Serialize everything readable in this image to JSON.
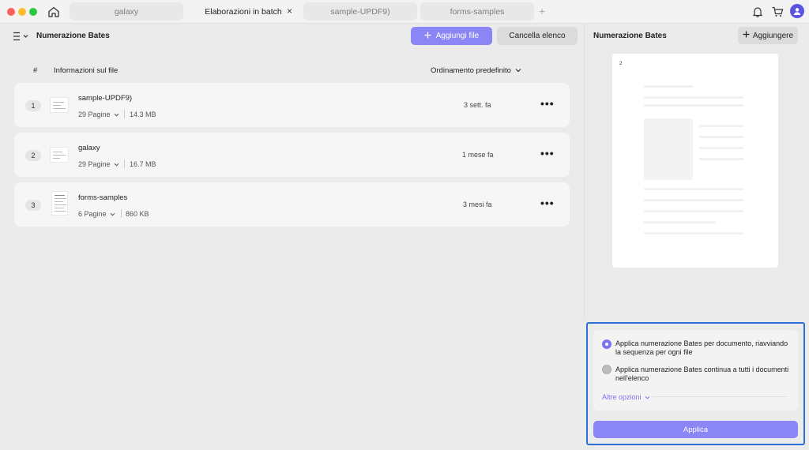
{
  "tabs": [
    {
      "label": "galaxy"
    },
    {
      "label": "Elaborazioni in batch"
    },
    {
      "label": "sample-UPDF9)"
    },
    {
      "label": "forms-samples"
    }
  ],
  "tab_close": "×",
  "tab_add": "+",
  "toolbar": {
    "title": "Numerazione Bates",
    "add_files_label": "Aggiungi file",
    "clear_list_label": "Cancella elenco"
  },
  "list": {
    "col_number": "#",
    "col_info": "Informazioni sul file",
    "sort_label": "Ordinamento predefinito",
    "rows": [
      {
        "index": "1",
        "name": "sample-UPDF9)",
        "pages": "29 Pagine",
        "size": "14.3 MB",
        "time": "3 sett. fa"
      },
      {
        "index": "2",
        "name": "galaxy",
        "pages": "29 Pagine",
        "size": "16.7 MB",
        "time": "1 mese fa"
      },
      {
        "index": "3",
        "name": "forms-samples",
        "pages": "6 Pagine",
        "size": "860 KB",
        "time": "3 mesi fa"
      }
    ],
    "more_glyph": "•••"
  },
  "right_panel": {
    "title": "Numerazione Bates",
    "add_label": "Aggiungere",
    "preview_stamp": "2",
    "option_per_document": "Applica numerazione Bates per documento, riavviando la sequenza per ogni file",
    "option_continuous": "Applica numerazione Bates continua a tutti i documenti nell'elenco",
    "selected_option": "option_per_document",
    "more_options_label": "Altre opzioni",
    "apply_label": "Applica"
  },
  "colors": {
    "accent": "#8b86f5",
    "highlight_border": "#2f6fd8"
  },
  "icons": [
    "home-icon",
    "bell-icon",
    "cart-icon",
    "user-avatar-icon",
    "list-menu-icon",
    "plus-icon",
    "chevron-down-icon",
    "more-icon"
  ]
}
